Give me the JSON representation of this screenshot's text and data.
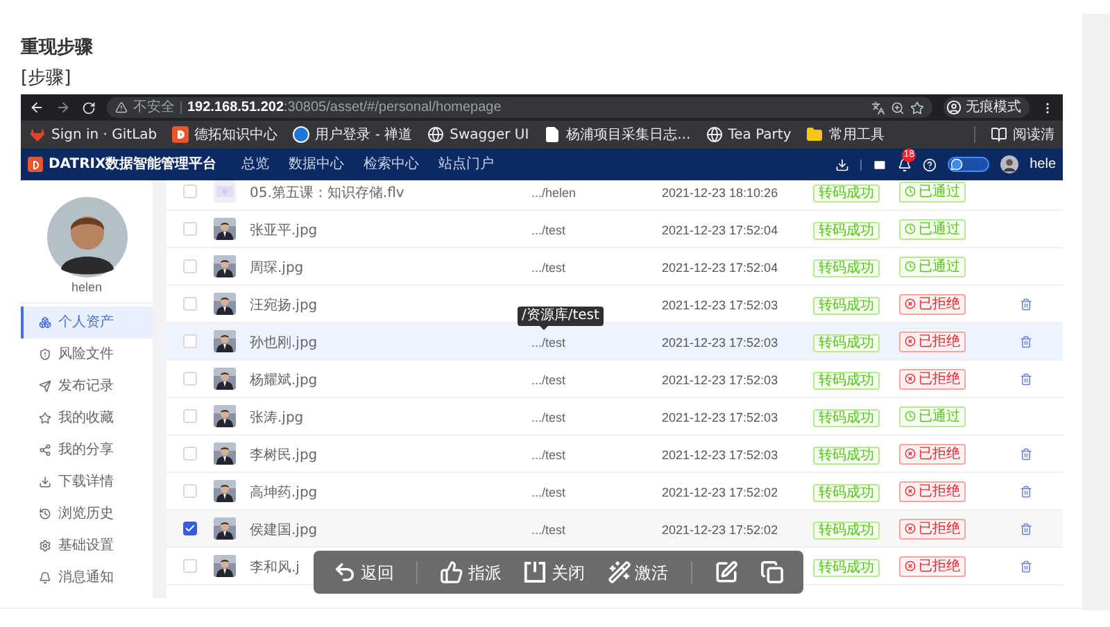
{
  "doc": {
    "heading": "重现步骤",
    "label": "[步骤]"
  },
  "browser": {
    "security": "不安全",
    "host": "192.168.51.202",
    "path": ":30805/asset/#/personal/homepage",
    "profile": "无痕模式"
  },
  "bookmarks": [
    {
      "label": "Sign in · GitLab",
      "kind": "gitlab"
    },
    {
      "label": "德拓知识中心",
      "kind": "square"
    },
    {
      "label": "用户登录 - 禅道",
      "kind": "zentao"
    },
    {
      "label": "Swagger UI",
      "kind": "globe"
    },
    {
      "label": "杨浦项目采集日志...",
      "kind": "page"
    },
    {
      "label": "Tea Party",
      "kind": "globe"
    },
    {
      "label": "常用工具",
      "kind": "folder"
    },
    {
      "label": "阅读清",
      "kind": "reading"
    }
  ],
  "app": {
    "title": "DATRIX数据智能管理平台",
    "nav": [
      "总览",
      "数据中心",
      "检索中心",
      "站点门户"
    ],
    "badge": "18",
    "user": "hele"
  },
  "sidebar": {
    "username": "helen",
    "items": [
      {
        "label": "个人资产",
        "kind": "asset",
        "selected": true
      },
      {
        "label": "风险文件",
        "kind": "risk",
        "selected": false
      },
      {
        "label": "发布记录",
        "kind": "publish",
        "selected": false
      },
      {
        "label": "我的收藏",
        "kind": "star",
        "selected": false
      },
      {
        "label": "我的分享",
        "kind": "share",
        "selected": false
      },
      {
        "label": "下载详情",
        "kind": "download",
        "selected": false
      },
      {
        "label": "浏览历史",
        "kind": "history",
        "selected": false
      },
      {
        "label": "基础设置",
        "kind": "settings",
        "selected": false
      },
      {
        "label": "消息通知",
        "kind": "bell",
        "selected": false
      }
    ]
  },
  "table": {
    "rows": [
      {
        "kind": "video",
        "name": "05.第五课：知识存储.flv",
        "path": ".../helen",
        "date": "2021-12-23 18:10:26",
        "transcode": "转码成功",
        "status": {
          "kind": "approved",
          "text": "已通过"
        },
        "deletable": false,
        "checked": false,
        "hovered": false
      },
      {
        "name": "张亚平.jpg",
        "path": ".../test",
        "date": "2021-12-23 17:52:04",
        "transcode": "转码成功",
        "status": {
          "kind": "approved",
          "text": "已通过"
        },
        "deletable": false,
        "checked": false,
        "hovered": false
      },
      {
        "name": "周琛.jpg",
        "path": ".../test",
        "date": "2021-12-23 17:52:04",
        "transcode": "转码成功",
        "status": {
          "kind": "approved",
          "text": "已通过"
        },
        "deletable": false,
        "checked": false,
        "hovered": false
      },
      {
        "name": "汪宛扬.jpg",
        "date": "2021-12-23 17:52:03",
        "transcode": "转码成功",
        "status": {
          "kind": "rejected",
          "text": "已拒绝"
        },
        "deletable": true,
        "checked": false,
        "hovered": false
      },
      {
        "name": "孙也刚.jpg",
        "path": ".../test",
        "date": "2021-12-23 17:52:03",
        "transcode": "转码成功",
        "status": {
          "kind": "rejected",
          "text": "已拒绝"
        },
        "deletable": true,
        "checked": false,
        "hovered": true
      },
      {
        "name": "杨耀斌.jpg",
        "path": ".../test",
        "date": "2021-12-23 17:52:03",
        "transcode": "转码成功",
        "status": {
          "kind": "rejected",
          "text": "已拒绝"
        },
        "deletable": true,
        "checked": false,
        "hovered": false
      },
      {
        "name": "张涛.jpg",
        "path": ".../test",
        "date": "2021-12-23 17:52:03",
        "transcode": "转码成功",
        "status": {
          "kind": "approved",
          "text": "已通过"
        },
        "deletable": false,
        "checked": false,
        "hovered": false
      },
      {
        "name": "李树民.jpg",
        "path": ".../test",
        "date": "2021-12-23 17:52:03",
        "transcode": "转码成功",
        "status": {
          "kind": "rejected",
          "text": "已拒绝"
        },
        "deletable": true,
        "checked": false,
        "hovered": false
      },
      {
        "name": "高坤药.jpg",
        "path": ".../test",
        "date": "2021-12-23 17:52:02",
        "transcode": "转码成功",
        "status": {
          "kind": "rejected",
          "text": "已拒绝"
        },
        "deletable": true,
        "checked": false,
        "hovered": false
      },
      {
        "name": "侯建国.jpg",
        "path": ".../test",
        "date": "2021-12-23 17:52:02",
        "transcode": "转码成功",
        "status": {
          "kind": "rejected",
          "text": "已拒绝"
        },
        "deletable": true,
        "checked": true,
        "hovered": false
      },
      {
        "name": "李和风.j",
        "transcode": "转码成功",
        "status": {
          "kind": "rejected",
          "text": "已拒绝"
        },
        "deletable": true,
        "checked": false,
        "hovered": false
      }
    ]
  },
  "tooltip": "/资源库/test",
  "toolbar": [
    {
      "kind": "undo",
      "label": "返回"
    },
    {
      "kind": "assign",
      "label": "指派"
    },
    {
      "kind": "close",
      "label": "关闭"
    },
    {
      "kind": "activate",
      "label": "激活"
    },
    {
      "kind": "edit"
    },
    {
      "kind": "copy"
    }
  ]
}
